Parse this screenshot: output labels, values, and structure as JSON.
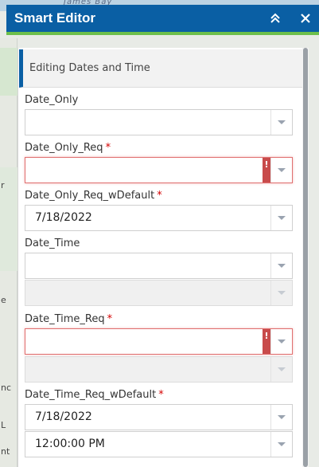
{
  "map": {
    "water_label": "James Bay",
    "edge_labels": [
      "r",
      "e",
      "nc",
      "L",
      "nt"
    ]
  },
  "header": {
    "title": "Smart Editor"
  },
  "section": {
    "title": "Editing Dates and Time"
  },
  "fields": [
    {
      "label": "Date_Only",
      "required": "",
      "value": ""
    },
    {
      "label": "Date_Only_Req",
      "required": "*",
      "value": "",
      "error_glyph": "!"
    },
    {
      "label": "Date_Only_Req_wDefault",
      "required": "*",
      "value": "7/18/2022"
    },
    {
      "label": "Date_Time",
      "required": "",
      "date_value": "",
      "time_value": ""
    },
    {
      "label": "Date_Time_Req",
      "required": "*",
      "date_value": "",
      "time_value": "",
      "error_glyph": "!"
    },
    {
      "label": "Date_Time_Req_wDefault",
      "required": "*",
      "date_value": "7/18/2022",
      "time_value": "12:00:00 PM"
    }
  ],
  "colors": {
    "header_bg": "#0a5fa4",
    "header_accent": "#6dbf4b",
    "required": "#d40000",
    "error": "#c84b4b"
  }
}
